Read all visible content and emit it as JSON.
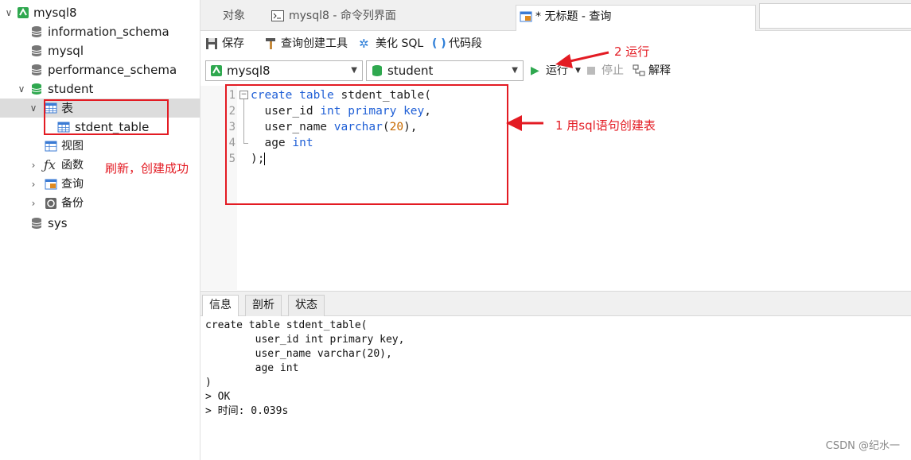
{
  "sidebar": {
    "connection": "mysql8",
    "databases": [
      "information_schema",
      "mysql",
      "performance_schema"
    ],
    "open_db": "student",
    "tables_node": "表",
    "table_item": "stdent_table",
    "view_node": "视图",
    "function_node": "函数",
    "query_node": "查询",
    "backup_node": "备份",
    "last_db": "sys"
  },
  "tabs": [
    {
      "label": "对象"
    },
    {
      "label": "mysql8 - 命令列界面"
    },
    {
      "label": "* 无标题 - 查询"
    }
  ],
  "toolbar": {
    "save": "保存",
    "query_builder": "查询创建工具",
    "beautify": "美化 SQL",
    "snippet": "代码段",
    "run": "运行",
    "stop": "停止",
    "explain": "解释",
    "connection_select": "mysql8",
    "database_select": "student"
  },
  "editor": {
    "line_numbers": [
      "1",
      "2",
      "3",
      "4",
      "5"
    ],
    "lines": [
      {
        "kw1": "create table",
        "rest": " stdent_table("
      },
      {
        "pre": "  user_id ",
        "kw1": "int primary key",
        "rest": ","
      },
      {
        "pre": "  user_name ",
        "kw1": "varchar",
        "paren": "(",
        "num": "20",
        "rest": "),"
      },
      {
        "pre": "  age ",
        "kw1": "int",
        "rest": ""
      },
      {
        "rest": ");"
      }
    ]
  },
  "bottom_tabs": [
    "信息",
    "剖析",
    "状态"
  ],
  "output": [
    "create table stdent_table(",
    "        user_id int primary key,",
    "        user_name varchar(20),",
    "        age int",
    ")",
    "> OK",
    "> 时间: 0.039s"
  ],
  "annotations": {
    "run_hint": "2 运行",
    "sql_hint": "1 用sql语句创建表",
    "refresh_hint": "刷新，创建成功"
  },
  "watermark": "CSDN @纪水一",
  "colors": {
    "annotation": "#e31b23",
    "keyword": "#1f5fd6",
    "number": "#c76a00",
    "db_green": "#2fa84f"
  }
}
